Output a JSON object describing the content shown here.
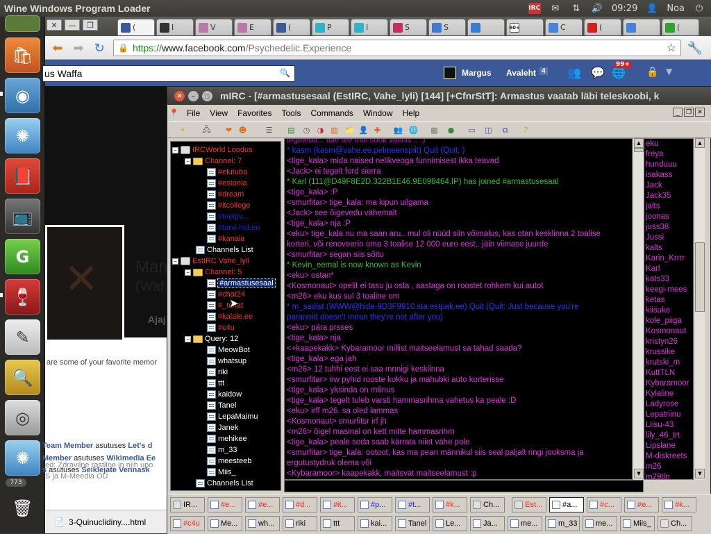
{
  "topbar": {
    "app_title": "Wine Windows Program Loader",
    "clock": "09:29",
    "user": "Noa"
  },
  "launcher": {
    "badge_count": "773"
  },
  "browser": {
    "url_https": "https://",
    "url_host": "www.facebook.com",
    "url_path": "/Psychedelic.Experience",
    "tabs": [
      {
        "label": "(",
        "icon": "facebook-icon",
        "color": "#3b5998"
      },
      {
        "label": "I",
        "icon": "rocket-icon",
        "color": "#333333"
      },
      {
        "label": "V",
        "icon": "cat-icon",
        "color": "#b87aa8"
      },
      {
        "label": "E",
        "icon": "cat-icon",
        "color": "#b87aa8"
      },
      {
        "label": "(",
        "icon": "facebook-icon",
        "color": "#3b5998"
      },
      {
        "label": "P",
        "icon": "bulb-icon",
        "color": "#2bb5c5"
      },
      {
        "label": "I",
        "icon": "bulb-icon",
        "color": "#2bb5c5"
      },
      {
        "label": "S",
        "icon": "star-icon",
        "color": "#c03060"
      },
      {
        "label": "S",
        "icon": "cloud-icon",
        "color": "#3d7bd0"
      },
      {
        "label": "",
        "icon": "cloud-icon",
        "color": "#3d7bd0"
      },
      {
        "label": "",
        "icon": "calendar-icon",
        "color": "#888888"
      },
      {
        "label": "C",
        "icon": "translate-icon",
        "color": "#4a80d8"
      },
      {
        "label": "(",
        "icon": "youtube-icon",
        "color": "#d02020"
      },
      {
        "label": "",
        "icon": "google-icon",
        "color": "#4a80d8"
      },
      {
        "label": "(",
        "icon": "puzzle-icon",
        "color": "#30a030"
      }
    ],
    "calendar_tab_text": "60+"
  },
  "facebook": {
    "search_value": "us Waffa",
    "nav_user": "Margus",
    "nav_home": "Avaleht",
    "nav_home_count": "4",
    "notif_count": "99+",
    "profile_name_partial": "Marg",
    "profile_sub_partial": "(Waf",
    "tab_partial": "Ajaj",
    "favorites_text": "are some of your favorite memor",
    "activity": [
      {
        "strong": "Team Member",
        "rest": " asutuses ",
        "strong2": "Let's d"
      },
      {
        "strong": "Member",
        "rest": " asutuses ",
        "strong2": "Wikimedia Ee"
      },
      {
        "strong": "s",
        "rest": " asutuses ",
        "strong2": "Seiklejate Vennask"
      }
    ],
    "sidebar_line1": "ed: Zdravilne rastline in njih upo",
    "sidebar_line2": "S ja M-Meedia OÜ",
    "download_file": "3-Quinuclidiny....html"
  },
  "mirc": {
    "title": "mIRC - [#armastusesaal (EstIRC, Vahe_lyli) [144] [+CfnrStT]: Armastus vaatab läbi teleskoobi, k",
    "menu": [
      "File",
      "View",
      "Favorites",
      "Tools",
      "Commands",
      "Window",
      "Help"
    ],
    "tree": {
      "net1": "IRCWorld Loodus",
      "net1_channels_label": "Channel: 7",
      "net1_channels": [
        {
          "name": "#elutuba",
          "color": "#ff3030"
        },
        {
          "name": "#estonia",
          "color": "#ff3030"
        },
        {
          "name": "#dream",
          "color": "#ff3030"
        },
        {
          "name": "#itcollege",
          "color": "#ff3030"
        },
        {
          "name": "#tneipv...",
          "color": "#2020e0"
        },
        {
          "name": "#tarvi.hot.ee",
          "color": "#2020e0"
        },
        {
          "name": "#kanala",
          "color": "#ff3030"
        }
      ],
      "net1_list": "Channels List",
      "net2": "EstIRC Vahe_lyli",
      "net2_channels_label": "Channel: 5",
      "net2_channels": [
        {
          "name": "#armastusesaal",
          "color": "#ffffff"
        },
        {
          "name": "#chat24",
          "color": "#ff3030"
        },
        {
          "name": "#_tchat",
          "color": "#ff3030"
        },
        {
          "name": "#kalale.ee",
          "color": "#ff3030"
        },
        {
          "name": "#c4u",
          "color": "#ff3030"
        }
      ],
      "query_label": "Query: 12",
      "queries": [
        "MeowBot",
        "whatsup",
        "riki",
        "ttt",
        "kaidow",
        "Tanel",
        "LepaMaimu",
        "Janek",
        "mehikee",
        "m_33",
        "meesteeb",
        "Miis_"
      ],
      "net2_list": "Channels List"
    },
    "chat": [
      {
        "text": "tegeleda... tule tee mul sook valmis .. :)",
        "color": "#d000d0"
      },
      {
        "text": "* kasm (kasm@vahe.ee.pelmeensplit) Quit (Quit: )",
        "color": "#3030ff"
      },
      {
        "text": "<tige_kala> mida naised nelikveoga funnimisest ikka teavad",
        "color": "#e030e0"
      },
      {
        "text": "<Jack> ei tegelt ford sierra",
        "color": "#e030e0"
      },
      {
        "text": "* Karl (111@D49F8E2D.322B1E46.9E098464.IP) has joined #armastusesaal",
        "color": "#30c030"
      },
      {
        "text": "<tige_kala> :P",
        "color": "#e030e0"
      },
      {
        "text": "<smurfitar> tige_kala: ma kipun uilgama",
        "color": "#e030e0"
      },
      {
        "text": "<Jack> see õigevedu vähemalt",
        "color": "#e030e0"
      },
      {
        "text": "<tige_kala> nja :P",
        "color": "#e030e0"
      },
      {
        "text": "<eku> tige_kala nu ma saan aru.. mul oli nüüd siin võimalus, kas otan kesklinna 2 toalise",
        "color": "#e030e0"
      },
      {
        "text": "   korteri, või renoveerin oma 3 toalise 12 000 euro eest.. jäin viimase juurde",
        "color": "#e030e0"
      },
      {
        "text": "<smurfitar> segan siis sõitu",
        "color": "#e030e0"
      },
      {
        "text": "* Kevin_eemal is now known as Kevin",
        "color": "#30c030"
      },
      {
        "text": "<eku> ostan*",
        "color": "#e030e0"
      },
      {
        "text": "<Kosmonaut> opelit ei tasu ju osta , aastaga on roostet rohkem kui autot",
        "color": "#e030e0"
      },
      {
        "text": "<m26> eku kus sul 3 toaline om",
        "color": "#e030e0"
      },
      {
        "text": "* m_sadist (WWW@hide-9D3F9910.sta.estpak.ee) Quit (Quit: Just because you're",
        "color": "#3030ff"
      },
      {
        "text": "   paranoid doesn't mean they're not after you)",
        "color": "#3030ff"
      },
      {
        "text": "<eku> pära prsses",
        "color": "#e030e0"
      },
      {
        "text": "<tige_kala> nja",
        "color": "#e030e0"
      },
      {
        "text": "<+kaapekakk> Kybaramoor millist maitseelamust sa tahad saada?",
        "color": "#e030e0"
      },
      {
        "text": "<tige_kala> ega jah",
        "color": "#e030e0"
      },
      {
        "text": "<m26> 12 tuhhi eest ei saa mnnigi kesklinna",
        "color": "#e030e0"
      },
      {
        "text": "<smurfitar> irw pyhid rooste kokku ja mahubki auto korterisse",
        "color": "#e030e0"
      },
      {
        "text": "<tige_kala> yksinda on m6nus",
        "color": "#e030e0"
      },
      {
        "text": "<tige_kala> tegelt tuleb varsti hammasrihma vahetus ka peale :D",
        "color": "#e030e0"
      },
      {
        "text": "<eku> irff m26. sa oled lammas",
        "color": "#e030e0"
      },
      {
        "text": "<Kosmonaut> smurfitsr irf jh",
        "color": "#e030e0"
      },
      {
        "text": "<m26> õigel masinal on kett mitte hammasrihm",
        "color": "#e030e0"
      },
      {
        "text": "<tige_kala> peale seda saab kärrata niiet vähe pole",
        "color": "#e030e0"
      },
      {
        "text": "<smurfitar> tige_kala: ootoot, kas ma pean männikul siis seal paljalt ringi jooksma ja",
        "color": "#e030e0"
      },
      {
        "text": "   ergutustydruk olema või",
        "color": "#e030e0"
      },
      {
        "text": "<Kybaramoor> kaapekakk, maitsvat maitseelamust :p",
        "color": "#e030e0"
      }
    ],
    "nicks": [
      "eku",
      "freya",
      "hunduuu",
      "isakass",
      "Jack",
      "Jack35",
      "jalts",
      "joonas",
      "juss38",
      "Jussi",
      "kalts",
      "Karin_Krrrr",
      "Karl",
      "kats33",
      "keegi-mees",
      "ketas",
      "kiisuke",
      "kole_piiga",
      "Kosmonaut",
      "kristyn26",
      "krussike",
      "krutski_m",
      "KuttTLN",
      "Kybaramoor",
      "Kylaline",
      "Ladyrose",
      "Lepatriinu",
      "Liisu-43",
      "lily_46_trt",
      "Lipslane",
      "M-diskreets",
      "m26",
      "m29tln"
    ],
    "switchbar_row1": [
      {
        "label": "IR...",
        "kind": "net",
        "color": "#000000"
      },
      {
        "label": "#e...",
        "kind": "chan",
        "color": "#ff2020"
      },
      {
        "label": "#e...",
        "kind": "chan",
        "color": "#ff2020"
      },
      {
        "label": "#d...",
        "kind": "chan",
        "color": "#ff2020"
      },
      {
        "label": "#it...",
        "kind": "chan",
        "color": "#ff2020"
      },
      {
        "label": "#p...",
        "kind": "chan",
        "color": "#2020e0"
      },
      {
        "label": "#t...",
        "kind": "chan",
        "color": "#2020e0"
      },
      {
        "label": "#k...",
        "kind": "chan",
        "color": "#ff2020"
      },
      {
        "label": "Ch...",
        "kind": "net",
        "color": "#000000"
      },
      {
        "label": "Est...",
        "kind": "net",
        "color": "#ff2020"
      },
      {
        "label": "#a...",
        "kind": "chan",
        "color": "#000000"
      },
      {
        "label": "#c...",
        "kind": "chan",
        "color": "#ff2020"
      },
      {
        "label": "#e...",
        "kind": "chan",
        "color": "#ff2020"
      },
      {
        "label": "#k...",
        "kind": "chan",
        "color": "#ff2020"
      }
    ],
    "switchbar_row2": [
      {
        "label": "#c4u",
        "kind": "chan",
        "color": "#ff2020"
      },
      {
        "label": "Me...",
        "kind": "chan",
        "color": "#000000"
      },
      {
        "label": "wh...",
        "kind": "chan",
        "color": "#000000"
      },
      {
        "label": "riki",
        "kind": "chan",
        "color": "#000000"
      },
      {
        "label": "ttt",
        "kind": "chan",
        "color": "#000000"
      },
      {
        "label": "kai...",
        "kind": "chan",
        "color": "#000000"
      },
      {
        "label": "Tanel",
        "kind": "chan",
        "color": "#000000"
      },
      {
        "label": "Le...",
        "kind": "chan",
        "color": "#000000"
      },
      {
        "label": "Ja...",
        "kind": "chan",
        "color": "#000000"
      },
      {
        "label": "me...",
        "kind": "chan",
        "color": "#000000"
      },
      {
        "label": "m_33",
        "kind": "chan",
        "color": "#000000"
      },
      {
        "label": "me...",
        "kind": "chan",
        "color": "#000000"
      },
      {
        "label": "Miis_",
        "kind": "chan",
        "color": "#000000"
      },
      {
        "label": "Ch...",
        "kind": "net",
        "color": "#000000"
      }
    ]
  }
}
